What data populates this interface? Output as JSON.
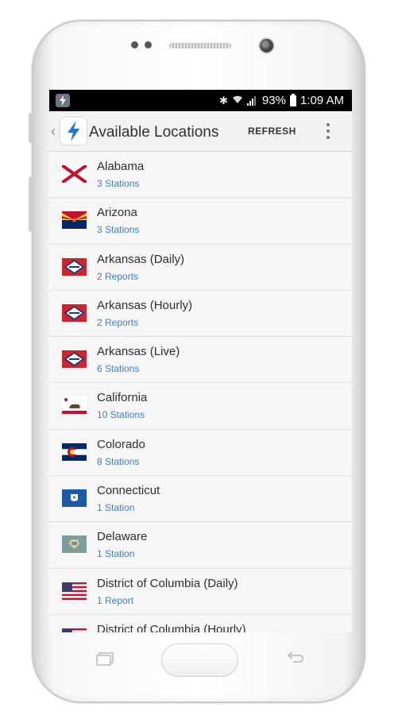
{
  "status_bar": {
    "battery": "93%",
    "time": "1:09 AM"
  },
  "app_bar": {
    "title": "Available Locations",
    "refresh_label": "REFRESH"
  },
  "locations": [
    {
      "name": "Alabama",
      "count": "3 Stations",
      "flag": "alabama-flag"
    },
    {
      "name": "Arizona",
      "count": "3 Stations",
      "flag": "arizona-flag"
    },
    {
      "name": "Arkansas (Daily)",
      "count": "2 Reports",
      "flag": "arkansas-flag"
    },
    {
      "name": "Arkansas (Hourly)",
      "count": "2 Reports",
      "flag": "arkansas-flag"
    },
    {
      "name": "Arkansas (Live)",
      "count": "6 Stations",
      "flag": "arkansas-flag"
    },
    {
      "name": "California",
      "count": "10 Stations",
      "flag": "california-flag"
    },
    {
      "name": "Colorado",
      "count": "8 Stations",
      "flag": "colorado-flag"
    },
    {
      "name": "Connecticut",
      "count": "1 Station",
      "flag": "connecticut-flag"
    },
    {
      "name": "Delaware",
      "count": "1 Station",
      "flag": "delaware-flag"
    },
    {
      "name": "District of Columbia (Daily)",
      "count": "1 Report",
      "flag": "dc-flag"
    },
    {
      "name": "District of Columbia (Hourly)",
      "count": "",
      "flag": "dc-flag"
    }
  ],
  "colors": {
    "accent_link": "#3c7ec9",
    "status_bar": "#000000",
    "app_bar": "#f2f2f2"
  }
}
